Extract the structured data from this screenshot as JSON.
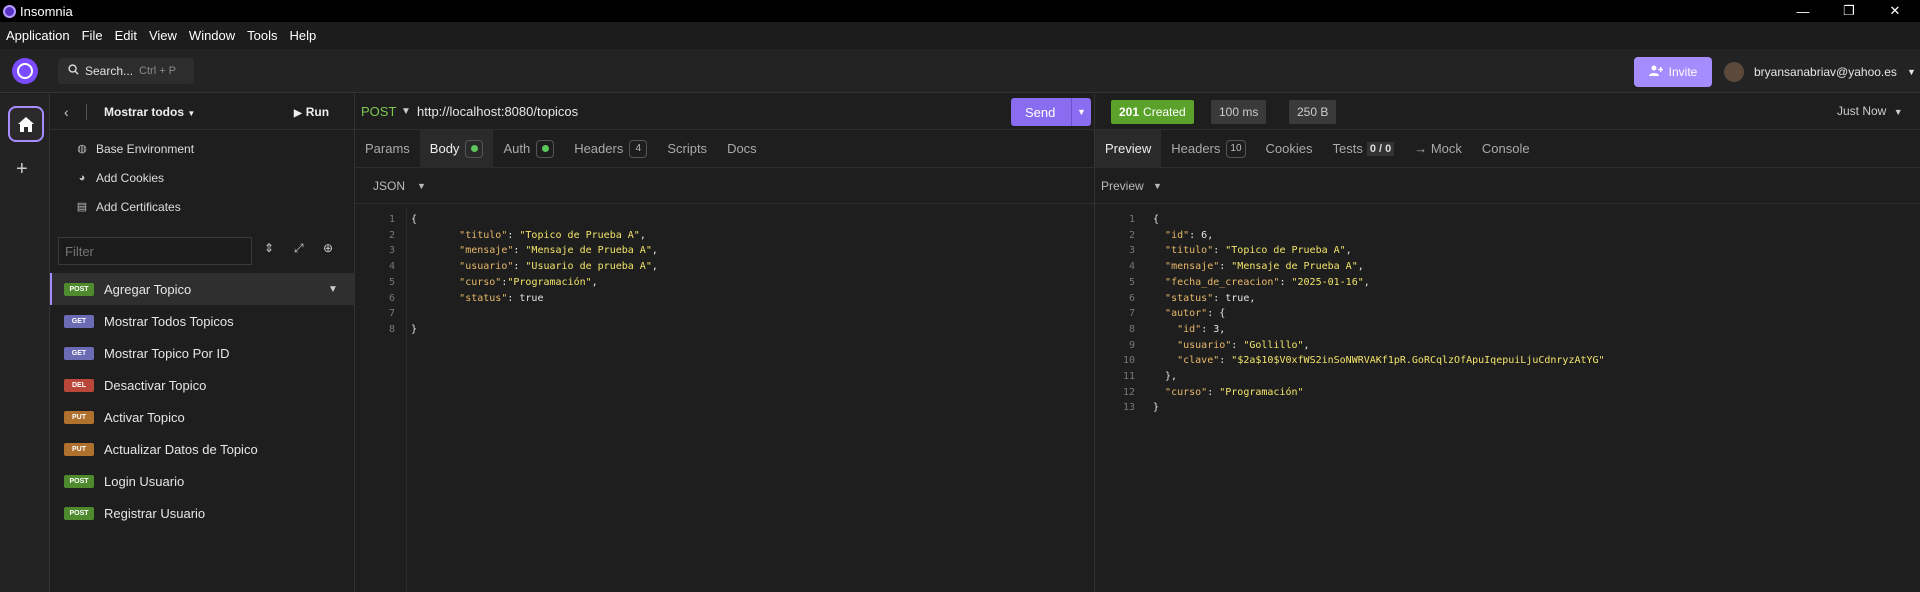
{
  "window": {
    "title": "Insomnia",
    "minimize": "—",
    "restore": "❐",
    "close": "✕"
  },
  "menu": [
    "Application",
    "File",
    "Edit",
    "View",
    "Window",
    "Tools",
    "Help"
  ],
  "header": {
    "search_label": "Search...",
    "search_shortcut": "Ctrl + P",
    "invite_label": "Invite",
    "user_email": "bryansanabriav@yahoo.es"
  },
  "sidebar": {
    "project": "Mostrar todos",
    "run_label": "Run",
    "env_items": [
      {
        "label": "Base Environment",
        "icon": "globe-icon"
      },
      {
        "label": "Add Cookies",
        "icon": "cookie-icon"
      },
      {
        "label": "Add Certificates",
        "icon": "certificate-icon"
      }
    ],
    "filter_placeholder": "Filter",
    "requests": [
      {
        "method": "POST",
        "name": "Agregar Topico",
        "color": "#4f8a2f",
        "active": true
      },
      {
        "method": "GET",
        "name": "Mostrar Todos Topicos",
        "color": "#6b6bb5"
      },
      {
        "method": "GET",
        "name": "Mostrar Topico Por ID",
        "color": "#6b6bb5"
      },
      {
        "method": "DEL",
        "name": "Desactivar Topico",
        "color": "#b8473a"
      },
      {
        "method": "PUT",
        "name": "Activar Topico",
        "color": "#b0712e"
      },
      {
        "method": "PUT",
        "name": "Actualizar Datos de Topico",
        "color": "#b0712e"
      },
      {
        "method": "POST",
        "name": "Login Usuario",
        "color": "#4f8a2f"
      },
      {
        "method": "POST",
        "name": "Registrar Usuario",
        "color": "#4f8a2f"
      }
    ]
  },
  "request": {
    "method": "POST",
    "url": "http://localhost:8080/topicos",
    "send_label": "Send",
    "tabs": {
      "params": "Params",
      "body": "Body",
      "auth": "Auth",
      "headers": "Headers",
      "headers_count": "4",
      "scripts": "Scripts",
      "docs": "Docs"
    },
    "body_type": "JSON",
    "line_numbers": [
      "1",
      "2",
      "3",
      "4",
      "5",
      "6",
      "7",
      "8"
    ],
    "body_lines": [
      {
        "parts": [
          [
            "n",
            "{"
          ]
        ]
      },
      {
        "parts": [
          [
            "n",
            "        "
          ],
          [
            "k",
            "\"titulo\""
          ],
          [
            "n",
            ": "
          ],
          [
            "s",
            "\"Topico de Prueba A\""
          ],
          [
            "n",
            ","
          ]
        ]
      },
      {
        "parts": [
          [
            "n",
            "        "
          ],
          [
            "k",
            "\"mensaje\""
          ],
          [
            "n",
            ": "
          ],
          [
            "s",
            "\"Mensaje de Prueba A\""
          ],
          [
            "n",
            ","
          ]
        ]
      },
      {
        "parts": [
          [
            "n",
            "        "
          ],
          [
            "k",
            "\"usuario\""
          ],
          [
            "n",
            ": "
          ],
          [
            "s",
            "\"Usuario de prueba A\""
          ],
          [
            "n",
            ","
          ]
        ]
      },
      {
        "parts": [
          [
            "n",
            "        "
          ],
          [
            "k",
            "\"curso\""
          ],
          [
            "n",
            ":"
          ],
          [
            "s",
            "\"Programación\""
          ],
          [
            "n",
            ","
          ]
        ]
      },
      {
        "parts": [
          [
            "n",
            "        "
          ],
          [
            "k",
            "\"status\""
          ],
          [
            "n",
            ": true"
          ]
        ]
      },
      {
        "parts": []
      },
      {
        "parts": [
          [
            "n",
            "}"
          ]
        ]
      }
    ]
  },
  "response": {
    "status_code": "201",
    "status_text": "Created",
    "time": "100 ms",
    "size": "250 B",
    "timestamp": "Just Now",
    "tabs": {
      "preview": "Preview",
      "headers": "Headers",
      "headers_count": "10",
      "cookies": "Cookies",
      "tests": "Tests",
      "tests_count": "0 / 0",
      "mock": "→ Mock",
      "console": "Console"
    },
    "preview_mode": "Preview",
    "line_numbers": [
      "1",
      "2",
      "3",
      "4",
      "5",
      "6",
      "7",
      "8",
      "9",
      "10",
      "11",
      "12",
      "13"
    ],
    "body_lines": [
      {
        "parts": [
          [
            "n",
            "{"
          ]
        ]
      },
      {
        "parts": [
          [
            "n",
            "  "
          ],
          [
            "k",
            "\"id\""
          ],
          [
            "n",
            ": 6,"
          ]
        ]
      },
      {
        "parts": [
          [
            "n",
            "  "
          ],
          [
            "k",
            "\"titulo\""
          ],
          [
            "n",
            ": "
          ],
          [
            "s",
            "\"Topico de Prueba A\""
          ],
          [
            "n",
            ","
          ]
        ]
      },
      {
        "parts": [
          [
            "n",
            "  "
          ],
          [
            "k",
            "\"mensaje\""
          ],
          [
            "n",
            ": "
          ],
          [
            "s",
            "\"Mensaje de Prueba A\""
          ],
          [
            "n",
            ","
          ]
        ]
      },
      {
        "parts": [
          [
            "n",
            "  "
          ],
          [
            "k",
            "\"fecha_de_creacion\""
          ],
          [
            "n",
            ": "
          ],
          [
            "s",
            "\"2025-01-16\""
          ],
          [
            "n",
            ","
          ]
        ]
      },
      {
        "parts": [
          [
            "n",
            "  "
          ],
          [
            "k",
            "\"status\""
          ],
          [
            "n",
            ": true,"
          ]
        ]
      },
      {
        "parts": [
          [
            "n",
            "  "
          ],
          [
            "k",
            "\"autor\""
          ],
          [
            "n",
            ": {"
          ]
        ]
      },
      {
        "parts": [
          [
            "n",
            "    "
          ],
          [
            "k",
            "\"id\""
          ],
          [
            "n",
            ": 3,"
          ]
        ]
      },
      {
        "parts": [
          [
            "n",
            "    "
          ],
          [
            "k",
            "\"usuario\""
          ],
          [
            "n",
            ": "
          ],
          [
            "s",
            "\"Gollillo\""
          ],
          [
            "n",
            ","
          ]
        ]
      },
      {
        "parts": [
          [
            "n",
            "    "
          ],
          [
            "k",
            "\"clave\""
          ],
          [
            "n",
            ": "
          ],
          [
            "s",
            "\"$2a$10$V0xfWS2inSoNWRVAKf1pR.GoRCqlzOfApuIqepuiLjuCdnryzAtYG\""
          ]
        ]
      },
      {
        "parts": [
          [
            "n",
            "  },"
          ]
        ]
      },
      {
        "parts": [
          [
            "n",
            "  "
          ],
          [
            "k",
            "\"curso\""
          ],
          [
            "n",
            ": "
          ],
          [
            "s",
            "\"Programación\""
          ]
        ]
      },
      {
        "parts": [
          [
            "n",
            "}"
          ]
        ]
      }
    ]
  }
}
